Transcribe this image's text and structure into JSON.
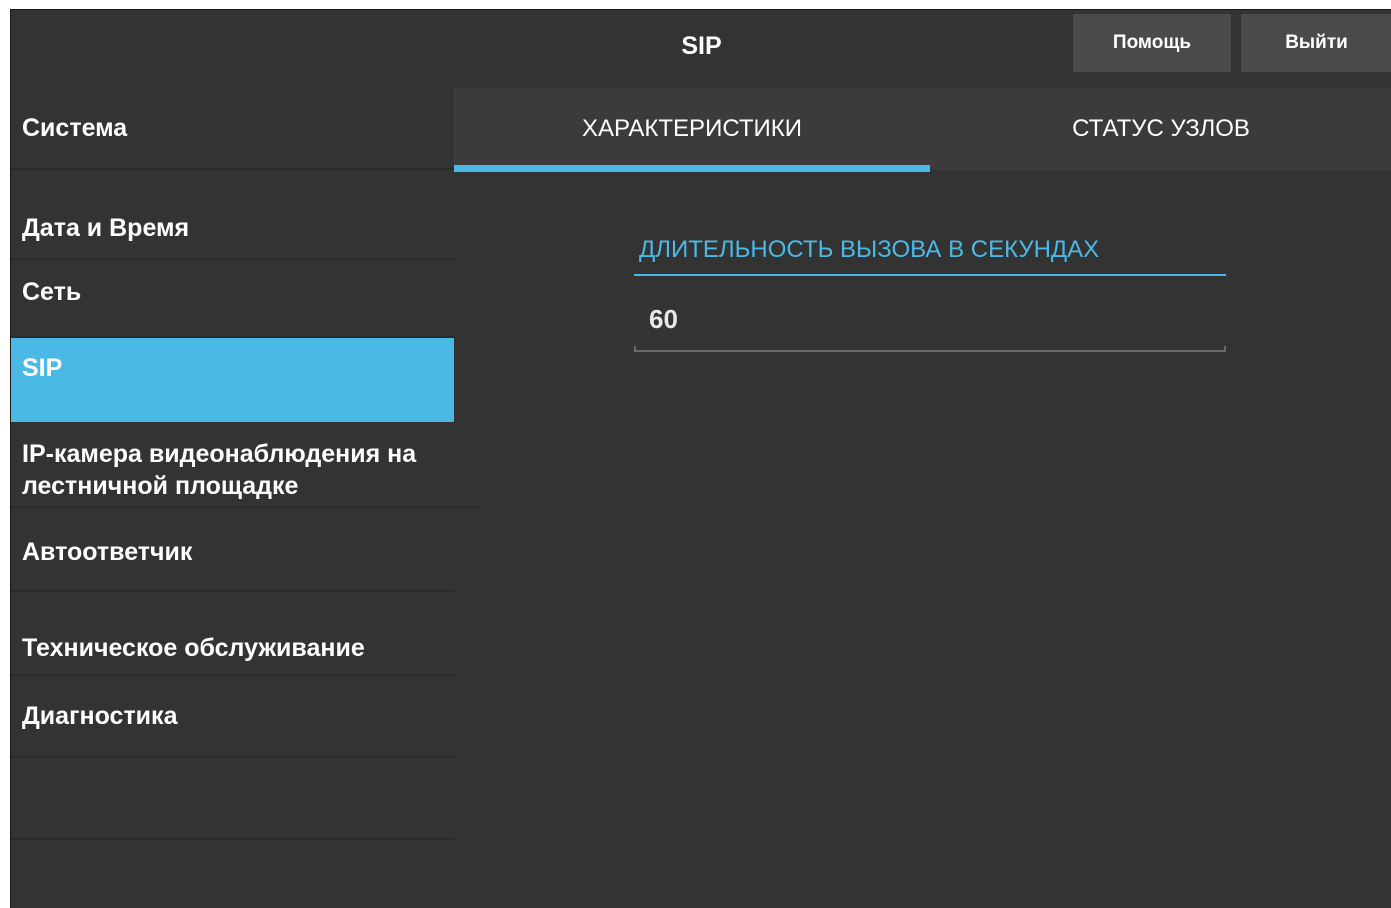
{
  "header": {
    "title": "SIP",
    "help_label": "Помощь",
    "logout_label": "Выйти"
  },
  "sidebar": {
    "section_title": "Система",
    "items": [
      {
        "label": "Дата и Время",
        "active": false
      },
      {
        "label": "Сеть",
        "active": false
      },
      {
        "label": "SIP",
        "active": true
      },
      {
        "label": "IP-камера видеонаблюдения на лестничной площадке",
        "active": false
      },
      {
        "label": "Автоответчик",
        "active": false
      },
      {
        "label": "Техническое обслуживание",
        "active": false
      },
      {
        "label": "Диагностика",
        "active": false
      }
    ]
  },
  "tabs": [
    {
      "label": "ХАРАКТЕРИСТИКИ",
      "active": true
    },
    {
      "label": "СТАТУС УЗЛОВ",
      "active": false
    }
  ],
  "form": {
    "call_duration_label": "ДЛИТЕЛЬНОСТЬ ВЫЗОВА В СЕКУНДАХ",
    "call_duration_value": "60"
  },
  "colors": {
    "accent": "#4bb9e6",
    "background": "#333333",
    "button": "#4a4a4a"
  }
}
